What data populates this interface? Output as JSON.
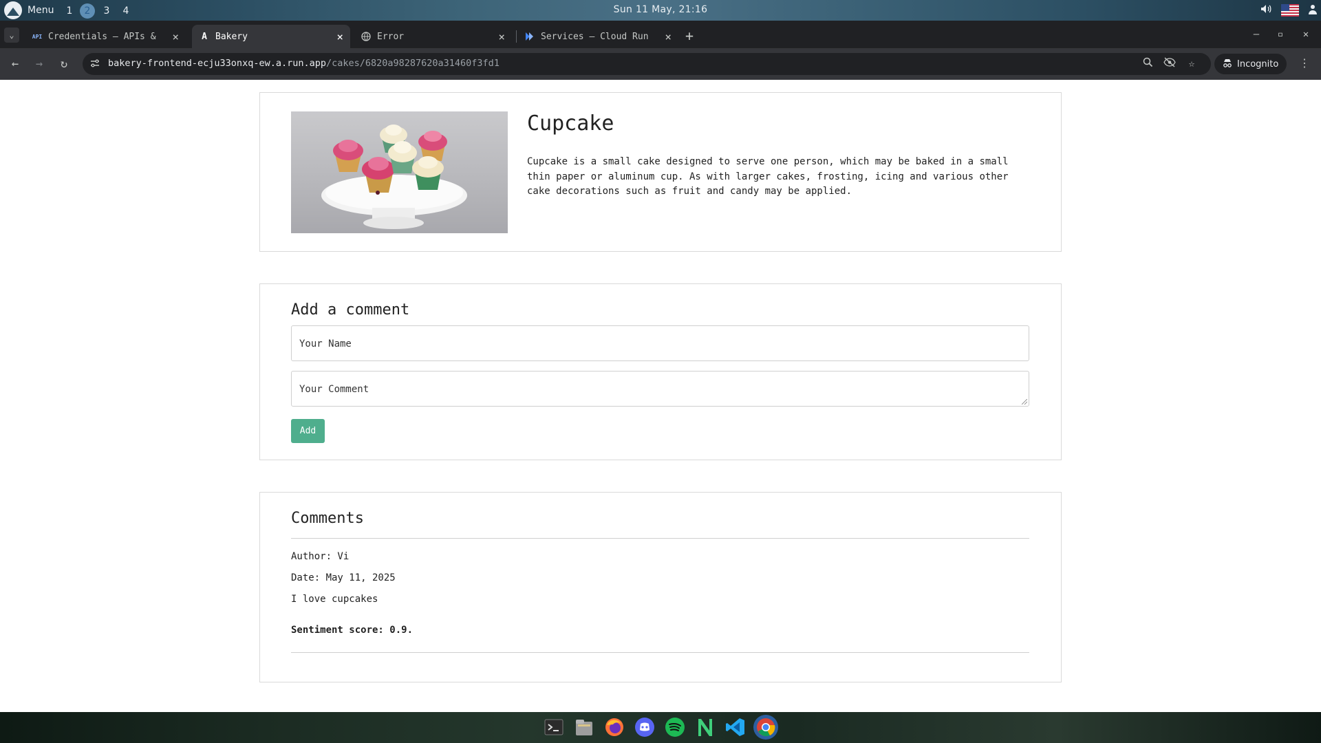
{
  "system_bar": {
    "menu_label": "Menu",
    "workspaces": [
      "1",
      "2",
      "3",
      "4"
    ],
    "active_workspace": "2",
    "clock": "Sun 11 May, 21:16"
  },
  "browser": {
    "tabs": [
      {
        "favicon_text": "API",
        "title": "Credentials – APIs &",
        "active": false
      },
      {
        "favicon_text": "A",
        "title": "Bakery",
        "active": true
      },
      {
        "favicon_text": "",
        "title": "Error",
        "active": false
      },
      {
        "favicon_text": "",
        "title": "Services – Cloud Run",
        "active": false
      }
    ],
    "address": {
      "domain": "bakery-frontend-ecju33onxq-ew.a.run.app",
      "path": "/cakes/6820a98287620a31460f3fd1"
    },
    "incognito_label": "Incognito"
  },
  "cake": {
    "name": "Cupcake",
    "description": "Cupcake is a small cake designed to serve one person, which may be baked in a small thin paper or aluminum cup. As with larger cakes, frosting, icing and various other cake decorations such as fruit and candy may be applied."
  },
  "add_comment": {
    "title": "Add a comment",
    "name_placeholder": "Your Name",
    "comment_placeholder": "Your Comment",
    "submit_label": "Add"
  },
  "comments": {
    "title": "Comments",
    "items": [
      {
        "author_line": "Author: Vi",
        "date_line": "Date: May 11, 2025",
        "text": "I love cupcakes",
        "sentiment_line": "Sentiment score: 0.9."
      }
    ]
  },
  "colors": {
    "accent_button": "#4fae8d",
    "browser_dark": "#202124",
    "toolbar": "#35363a"
  },
  "taskbar": {
    "apps": [
      "terminal-icon",
      "files-icon",
      "firefox-icon",
      "discord-icon",
      "spotify-icon",
      "n-app-icon",
      "vscode-icon",
      "chrome-icon"
    ]
  }
}
